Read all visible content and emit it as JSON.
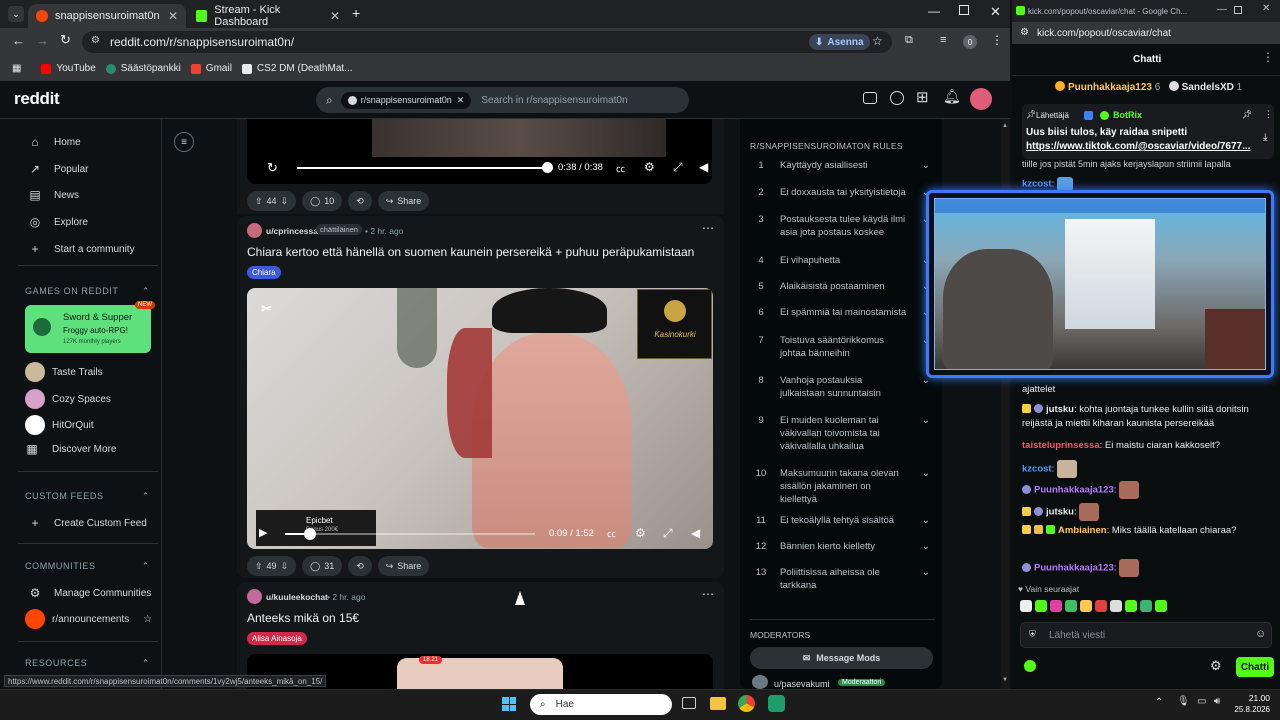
{
  "browser": {
    "tabs": [
      {
        "label": "snappisensuroimat0n"
      },
      {
        "label": "Stream - Kick Dashboard"
      }
    ],
    "url": "reddit.com/r/snappisensuroimat0n/",
    "install_label": "Asenna",
    "ext_count": "0",
    "bookmarks": [
      "YouTube",
      "Säästöpankki",
      "Gmail",
      "CS2 DM (DeathMat..."
    ]
  },
  "reddit": {
    "logo": "reddit",
    "search_chip": "r/snappisensuroimat0n",
    "search_placeholder": "Search in r/snappisensuroimat0n",
    "nav": {
      "home": "Home",
      "popular": "Popular",
      "news": "News",
      "explore": "Explore",
      "start": "Start a community"
    },
    "games_header": "GAMES ON REDDIT",
    "game_card": {
      "title": "Sword & Supper",
      "subtitle": "Froggy auto-RPG!",
      "users": "127K monthly players",
      "badge": "NEW"
    },
    "games": [
      "Taste Trails",
      "Cozy Spaces",
      "HitOrQuit",
      "Discover More"
    ],
    "custom_header": "CUSTOM FEEDS",
    "create_feed": "Create Custom Feed",
    "communities_header": "COMMUNITIES",
    "manage": "Manage Communities",
    "announcements": "r/announcements",
    "resources_header": "RESOURCES",
    "post0": {
      "time": "0:38 / 0:38",
      "votes": "44",
      "comments": "10",
      "share": "Share"
    },
    "post1": {
      "user": "u/cprincessa",
      "user_flair": "chättiläinen",
      "age": "• 2 hr. ago",
      "title": "Chiara kertoo että hänellä on suomen kaunein persereikä + puhuu peräpukamistaan",
      "flair": "Chiara",
      "time": "0:09 / 1:52",
      "ad_name": "Epicbet",
      "ad_sub": "Bonus 200€",
      "logo_text": "Kasinokurki",
      "votes": "49",
      "comments": "31",
      "share": "Share"
    },
    "post2": {
      "user": "u/kuuleekochat",
      "age": "• 2 hr. ago",
      "title": "Anteeks mikä on 15€",
      "flair": "Alisa Ainasoja"
    },
    "rules_header": "R/SNAPPISENSUROIMATON RULES",
    "rules": [
      {
        "n": "1",
        "t": "Käyttäydy asiallisesti"
      },
      {
        "n": "2",
        "t": "Ei doxxausta tai yksityistietoja"
      },
      {
        "n": "3",
        "t": "Postauksesta tulee käydä ilmi asia jota postaus koskee"
      },
      {
        "n": "4",
        "t": "Ei vihapuhetta"
      },
      {
        "n": "5",
        "t": "Alaikäisistä postaaminen"
      },
      {
        "n": "6",
        "t": "Ei spämmiä tai mainostamista"
      },
      {
        "n": "7",
        "t": "Toistuva sääntörikkomus johtaa bänneihin"
      },
      {
        "n": "8",
        "t": "Vanhoja postauksia julkaistaan sunnuntaisin"
      },
      {
        "n": "9",
        "t": "Ei muiden kuoleman tai väkivallan toivomista tai väkivallalla uhkailua"
      },
      {
        "n": "10",
        "t": "Maksumuurin takana olevan sisällön jakaminen on kiellettyä"
      },
      {
        "n": "11",
        "t": "Ei tekoälyllä tehtyä sisältöä"
      },
      {
        "n": "12",
        "t": "Bännien kierto kielletty"
      },
      {
        "n": "13",
        "t": "Poliittisissa aiheissa ole tarkkana"
      }
    ],
    "moderators_header": "MODERATORS",
    "message_mods": "Message Mods",
    "mod_user": "u/pasevakumi",
    "mod_badge": "Moderaattori",
    "status_url": "https://www.reddit.com/r/snappisensuroimat0n/comments/1vy2wj5/anteeks_mikä_on_15/"
  },
  "taskbar": {
    "search": "Hae",
    "time": "21.00",
    "date": "25.8.2026"
  },
  "kick": {
    "window_title": "kick.com/popout/oscaviar/chat - Google Ch...",
    "url": "kick.com/popout/oscaviar/chat",
    "header": "Chatti",
    "gifters": [
      {
        "name": "Puunhakkaaja123",
        "count": "6"
      },
      {
        "name": "SandelsXD",
        "count": "1"
      }
    ],
    "pinned": {
      "label": "Lähettäjä",
      "user": "BotRix",
      "text": "Uus biisi tulos, käy raidaa snipetti",
      "link": "https://www.tiktok.com/@oscaviar/video/7677..."
    },
    "partial_line": "tiille jos pistät 5min ajaks kerjayslapun striimii lapalla",
    "messages": [
      {
        "user": "kzcost",
        "text": "",
        "color": "#4f9cff"
      },
      {
        "user": "",
        "text": "ajattelet",
        "color": "#e8eaed"
      },
      {
        "user": "jutsku",
        "text": "kohta juontaja tunkee kullin siitä donitsin reijästä ja miettii kiharan kaunista persereikää",
        "color": "#e8eaed"
      },
      {
        "user": "taisteluprinsessa",
        "text": "Ei maistu ciaran kakkoselt?",
        "color": "#ff4d6a"
      },
      {
        "user": "kzcost",
        "text": "",
        "color": "#4f9cff"
      },
      {
        "user": "Puunhakkaaja123",
        "text": "",
        "color": "#b57cff"
      },
      {
        "user": "jutsku",
        "text": "",
        "color": "#e8eaed"
      },
      {
        "user": "Ambiainen",
        "text": "Miks täällä katellaan chiaraa?",
        "color": "#ffc94d"
      },
      {
        "user": "Puunhakkaaja123",
        "text": "",
        "color": "#b57cff"
      }
    ],
    "followers_only": "Vain seuraajat",
    "input_placeholder": "Lähetä viesti",
    "send": "Chatti",
    "accent": "#53fc18"
  }
}
